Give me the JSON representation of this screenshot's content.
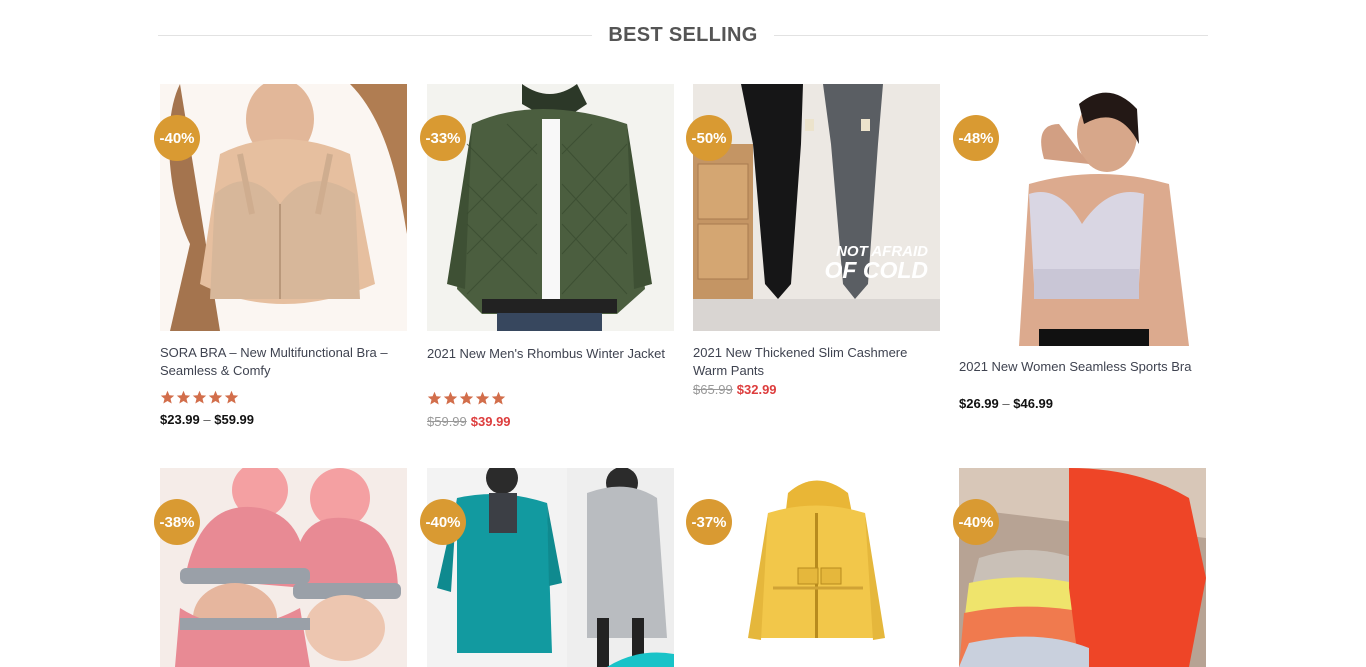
{
  "section": {
    "title": "BEST SELLING"
  },
  "colors": {
    "badge": "#d99a32",
    "star": "#d26e4b",
    "sale_price": "#dd3d3d"
  },
  "products": [
    {
      "badge": "-40%",
      "name": "SORA BRA – New Multifunctional Bra – Seamless & Comfy",
      "rating": 5,
      "price_from": "$23.99",
      "price_sep": "–",
      "price_to": "$59.99"
    },
    {
      "badge": "-33%",
      "name": "2021 New Men's Rhombus Winter Jacket",
      "rating": 5,
      "old_price": "$59.99",
      "sale_price": "$39.99"
    },
    {
      "badge": "-50%",
      "name": "2021 New Thickened Slim Cashmere Warm Pants",
      "old_price": "$65.99",
      "sale_price": "$32.99",
      "image_text": [
        "NOT AFRAID",
        "OF COLD"
      ]
    },
    {
      "badge": "-48%",
      "name": "2021 New Women Seamless Sports Bra",
      "price_from": "$26.99",
      "price_sep": "–",
      "price_to": "$46.99"
    },
    {
      "badge": "-38%"
    },
    {
      "badge": "-40%"
    },
    {
      "badge": "-37%"
    },
    {
      "badge": "-40%"
    }
  ]
}
